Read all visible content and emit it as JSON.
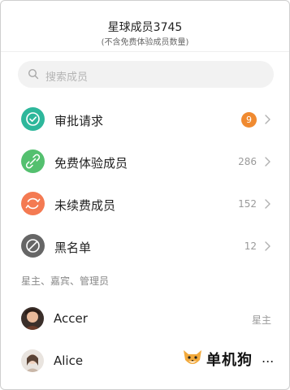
{
  "header": {
    "title": "星球成员3745",
    "subtitle": "(不含免费体验成员数量)"
  },
  "search": {
    "placeholder": "搜索成员",
    "icon": "search-icon"
  },
  "menu": [
    {
      "label": "审批请求",
      "badge": "9",
      "icon": "check-circle-icon",
      "color": "#2db79b"
    },
    {
      "label": "免费体验成员",
      "count": "286",
      "icon": "link-icon",
      "color": "#54c06f"
    },
    {
      "label": "未续费成员",
      "count": "152",
      "icon": "refresh-icon",
      "color": "#f47a52"
    },
    {
      "label": "黑名单",
      "count": "12",
      "icon": "block-icon",
      "color": "#666666"
    }
  ],
  "section": {
    "title": "星主、嘉宾、管理员"
  },
  "members": [
    {
      "name": "Accer",
      "role": "星主"
    },
    {
      "name": "Alice",
      "role": ""
    }
  ],
  "watermark": {
    "text": "单机狗",
    "dots": "..."
  },
  "colors": {
    "badge": "#f08a30",
    "search_bg": "#f2f2f2"
  }
}
